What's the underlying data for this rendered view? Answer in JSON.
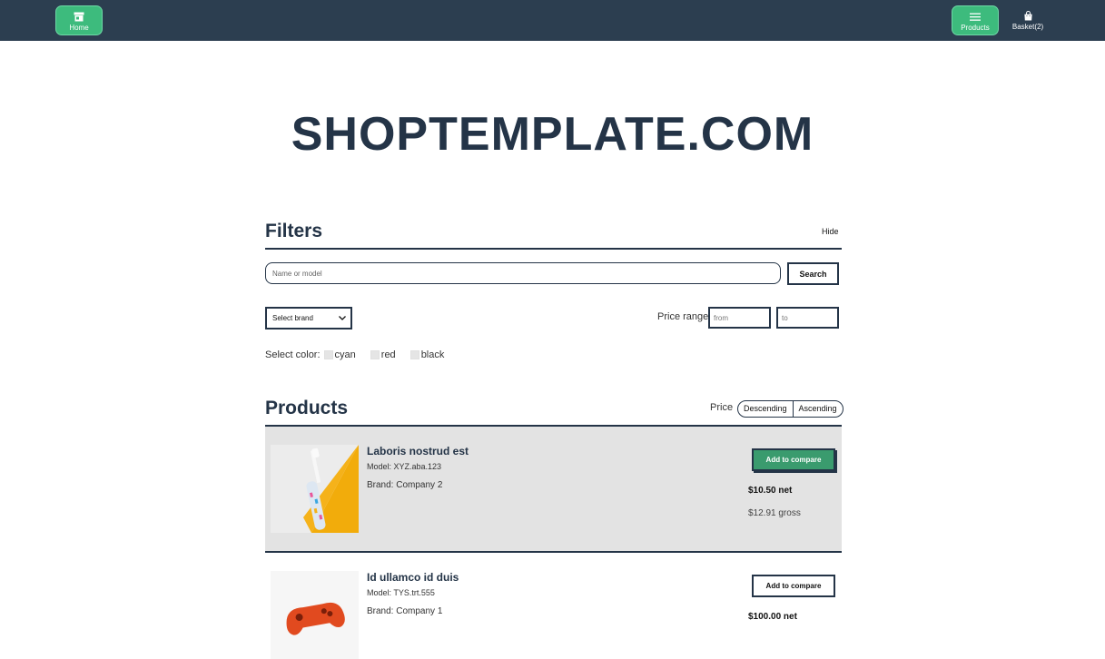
{
  "nav": {
    "home_label": "Home",
    "products_label": "Products",
    "basket_label": "Basket(2)"
  },
  "brand": {
    "title": "SHOPTEMPLATE.COM"
  },
  "filters": {
    "title": "Filters",
    "hide_label": "Hide",
    "search_placeholder": "Name or model",
    "search_button": "Search",
    "brand_select": "Select brand",
    "price_range_label": "Price range",
    "price_from_placeholder": "from",
    "price_to_placeholder": "to",
    "color_label": "Select color:",
    "colors": [
      "cyan",
      "red",
      "black"
    ]
  },
  "products": {
    "title": "Products",
    "sort_label": "Price",
    "sort_desc": "Descending",
    "sort_asc": "Ascending",
    "items": [
      {
        "name": "Laboris nostrud est",
        "model": "Model: XYZ.aba.123",
        "brand": "Brand: Company 2",
        "compare_label": "Add to compare",
        "net": "$10.50 net",
        "gross": "$12.91 gross",
        "image_icon": "toothbrush-image"
      },
      {
        "name": "Id ullamco id duis",
        "model": "Model: TYS.trt.555",
        "brand": "Brand: Company 1",
        "compare_label": "Add to compare",
        "net": "$100.00 net",
        "image_icon": "gamepad-image"
      }
    ]
  },
  "colors": {
    "topbar": "#2c3e50",
    "accent": "#3dbb7d",
    "text": "#243447"
  }
}
